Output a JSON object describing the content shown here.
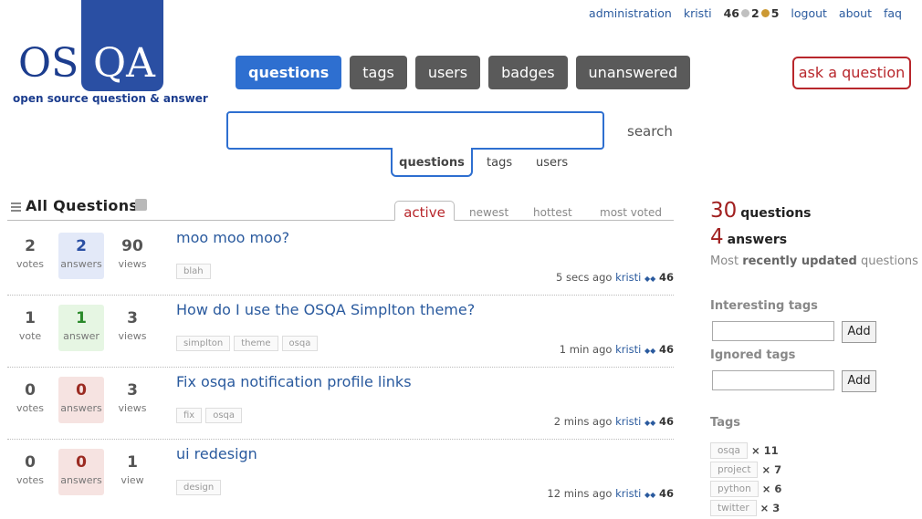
{
  "logo": {
    "left": "OS",
    "right": "QA",
    "subtitle": "open source question & answer"
  },
  "userbar": {
    "admin_link": "administration",
    "username": "kristi",
    "reputation": "46",
    "silver_count": "2",
    "bronze_count": "5",
    "logout": "logout",
    "about": "about",
    "faq": "faq"
  },
  "nav": {
    "items": [
      "questions",
      "tags",
      "users",
      "badges",
      "unanswered"
    ],
    "active": "questions",
    "ask": "ask a question"
  },
  "search": {
    "value": "",
    "button": "search",
    "scopes": [
      "questions",
      "tags",
      "users"
    ]
  },
  "main": {
    "title": "All Questions",
    "tabs": [
      "active",
      "newest",
      "hottest",
      "most voted"
    ]
  },
  "questions": [
    {
      "votes": "2",
      "votes_label": "votes",
      "answers": "2",
      "answers_label": "answers",
      "views": "90",
      "views_label": "views",
      "title": "moo moo moo?",
      "tags": [
        "blah"
      ],
      "time": "5 secs ago",
      "user": "kristi",
      "rep": "46"
    },
    {
      "votes": "1",
      "votes_label": "vote",
      "answers": "1",
      "answers_label": "answer",
      "views": "3",
      "views_label": "views",
      "title": "How do I use the OSQA Simplton theme?",
      "tags": [
        "simplton",
        "theme",
        "osqa"
      ],
      "time": "1 min ago",
      "user": "kristi",
      "rep": "46"
    },
    {
      "votes": "0",
      "votes_label": "votes",
      "answers": "0",
      "answers_label": "answers",
      "views": "3",
      "views_label": "views",
      "title": "Fix osqa notification profile links",
      "tags": [
        "fix",
        "osqa"
      ],
      "time": "2 mins ago",
      "user": "kristi",
      "rep": "46"
    },
    {
      "votes": "0",
      "votes_label": "votes",
      "answers": "0",
      "answers_label": "answers",
      "views": "1",
      "views_label": "view",
      "title": "ui redesign",
      "tags": [
        "design"
      ],
      "time": "12 mins ago",
      "user": "kristi",
      "rep": "46"
    }
  ],
  "sidebar": {
    "question_count": "30",
    "question_label": "questions",
    "answer_count": "4",
    "answer_label": "answers",
    "recent_prefix": "Most",
    "recent_bold": "recently updated",
    "recent_suffix": "questions",
    "interesting_title": "Interesting tags",
    "ignored_title": "Ignored tags",
    "add_label": "Add",
    "tags_title": "Tags",
    "tags": [
      {
        "name": "osqa",
        "count": "× 11"
      },
      {
        "name": "project",
        "count": "× 7"
      },
      {
        "name": "python",
        "count": "× 6"
      },
      {
        "name": "twitter",
        "count": "× 3"
      }
    ]
  },
  "colors": {
    "accent": "#2e6fd0",
    "brand": "#2a4fa3",
    "ask": "#b8272c"
  }
}
